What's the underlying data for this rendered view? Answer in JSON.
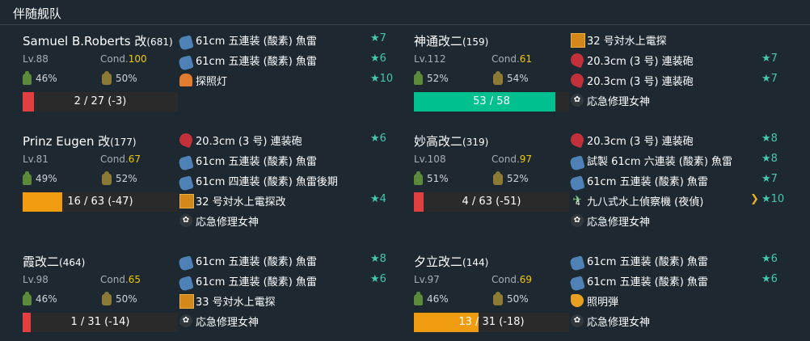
{
  "header": {
    "title": "伴随舰队"
  },
  "colors": {
    "cond_high": "#f0c800",
    "cond_normal": "#ffffff",
    "hp_green": "#00c090",
    "hp_orange": "#f09c10",
    "hp_red": "#e04040",
    "star": "#45c8b0"
  },
  "ships": [
    {
      "name": "Samuel B.Roberts 改",
      "id": "(681)",
      "lv": "Lv.88",
      "cond_label": "Cond.",
      "cond": "100",
      "fuel": "46%",
      "ammo": "50%",
      "hp_text": "2 / 27 (-3)",
      "hp_fraction": 0.074,
      "hp_color": "#e04040",
      "equipment": [
        {
          "icon": "torpedo-icon",
          "name": "61cm 五連装 (酸素) 魚雷",
          "star": "★7"
        },
        {
          "icon": "torpedo-icon",
          "name": "61cm 五連装 (酸素) 魚雷",
          "star": "★6"
        },
        {
          "icon": "searchlight-icon",
          "name": "探照灯",
          "star": "★10"
        }
      ]
    },
    {
      "name": "神通改二",
      "id": "(159)",
      "lv": "Lv.112",
      "cond_label": "Cond.",
      "cond": "61",
      "fuel": "52%",
      "ammo": "54%",
      "hp_text": "53 / 58",
      "hp_fraction": 0.914,
      "hp_color": "#00c090",
      "equipment": [
        {
          "icon": "radar-icon",
          "name": "32 号対水上電探",
          "star": ""
        },
        {
          "icon": "main-gun-icon",
          "name": "20.3cm (3 号) 連装砲",
          "star": "★7"
        },
        {
          "icon": "main-gun-icon",
          "name": "20.3cm (3 号) 連装砲",
          "star": "★7"
        },
        {
          "icon": "repair-goddess-icon",
          "name": "応急修理女神",
          "star": ""
        }
      ]
    },
    {
      "name": "Prinz Eugen 改",
      "id": "(177)",
      "lv": "Lv.81",
      "cond_label": "Cond.",
      "cond": "67",
      "fuel": "49%",
      "ammo": "52%",
      "hp_text": "16 / 63 (-47)",
      "hp_fraction": 0.254,
      "hp_color": "#f09c10",
      "equipment": [
        {
          "icon": "main-gun-icon",
          "name": "20.3cm (3 号) 連装砲",
          "star": "★6"
        },
        {
          "icon": "torpedo-icon",
          "name": "61cm 五連装 (酸素) 魚雷",
          "star": ""
        },
        {
          "icon": "torpedo-icon",
          "name": "61cm 四連装 (酸素) 魚雷後期",
          "star": ""
        },
        {
          "icon": "radar-icon",
          "name": "32 号対水上電探改",
          "star": "★4"
        },
        {
          "icon": "repair-goddess-icon",
          "name": "応急修理女神",
          "star": ""
        }
      ]
    },
    {
      "name": "妙高改二",
      "id": "(319)",
      "lv": "Lv.108",
      "cond_label": "Cond.",
      "cond": "97",
      "fuel": "51%",
      "ammo": "52%",
      "hp_text": "4 / 63 (-51)",
      "hp_fraction": 0.063,
      "hp_color": "#e04040",
      "equipment": [
        {
          "icon": "main-gun-icon",
          "name": "20.3cm (3 号) 連装砲",
          "star": "★8"
        },
        {
          "icon": "torpedo-icon",
          "name": "試製 61cm 六連装 (酸素) 魚雷",
          "star": "★8"
        },
        {
          "icon": "torpedo-icon",
          "name": "61cm 五連装 (酸素) 魚雷",
          "star": "★7"
        },
        {
          "icon": "seaplane-icon",
          "name": "九八式水上偵察機 (夜偵)",
          "star": "★10",
          "slot": "4",
          "proficiency": "chevron-icon"
        },
        {
          "icon": "repair-goddess-icon",
          "name": "応急修理女神",
          "star": ""
        }
      ]
    },
    {
      "name": "霞改二",
      "id": "(464)",
      "lv": "Lv.98",
      "cond_label": "Cond.",
      "cond": "65",
      "fuel": "46%",
      "ammo": "50%",
      "hp_text": "1 / 31 (-14)",
      "hp_fraction": 0.032,
      "hp_color": "#e04040",
      "equipment": [
        {
          "icon": "torpedo-icon",
          "name": "61cm 五連装 (酸素) 魚雷",
          "star": "★8"
        },
        {
          "icon": "torpedo-icon",
          "name": "61cm 五連装 (酸素) 魚雷",
          "star": "★6"
        },
        {
          "icon": "radar-icon",
          "name": "33 号対水上電探",
          "star": ""
        },
        {
          "icon": "repair-goddess-icon",
          "name": "応急修理女神",
          "star": ""
        }
      ]
    },
    {
      "name": "夕立改二",
      "id": "(144)",
      "lv": "Lv.97",
      "cond_label": "Cond.",
      "cond": "69",
      "fuel": "46%",
      "ammo": "50%",
      "hp_text": "13 / 31 (-18)",
      "hp_fraction": 0.419,
      "hp_color": "#f09c10",
      "equipment": [
        {
          "icon": "torpedo-icon",
          "name": "61cm 五連装 (酸素) 魚雷",
          "star": "★6"
        },
        {
          "icon": "torpedo-icon",
          "name": "61cm 五連装 (酸素) 魚雷",
          "star": "★6"
        },
        {
          "icon": "flare-icon",
          "name": "照明弾",
          "star": ""
        },
        {
          "icon": "repair-goddess-icon",
          "name": "応急修理女神",
          "star": ""
        }
      ]
    }
  ]
}
